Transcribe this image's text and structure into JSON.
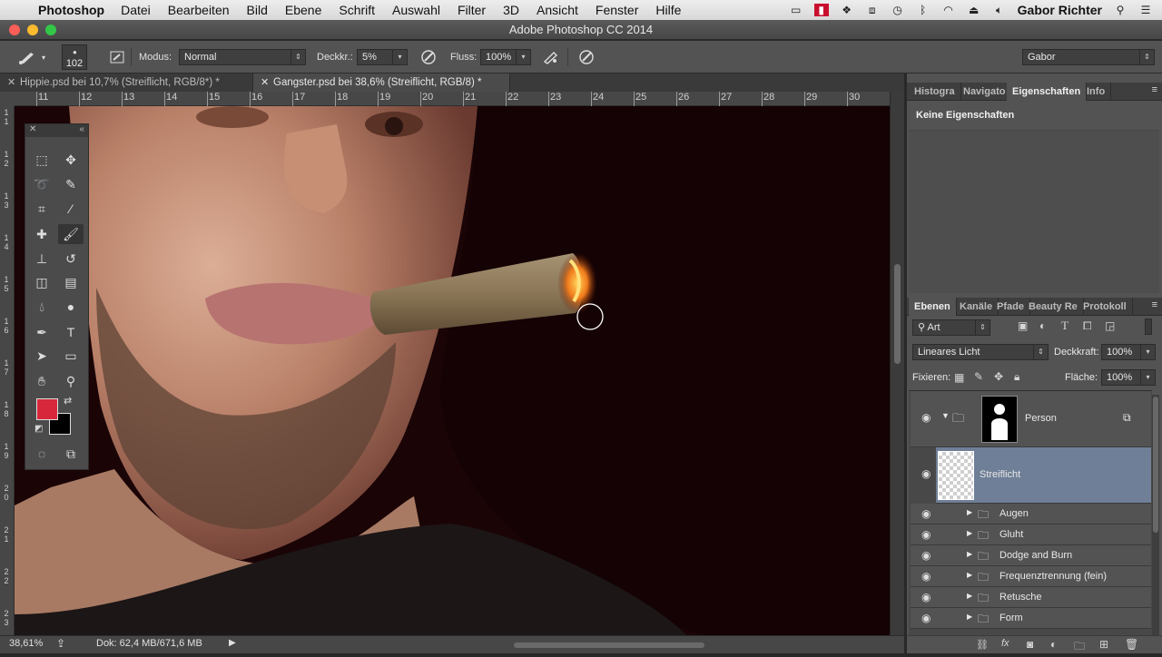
{
  "menubar": {
    "app": "Photoshop",
    "items": [
      "Datei",
      "Bearbeiten",
      "Bild",
      "Ebene",
      "Schrift",
      "Auswahl",
      "Filter",
      "3D",
      "Ansicht",
      "Fenster",
      "Hilfe"
    ],
    "user": "Gabor Richter"
  },
  "window": {
    "title": "Adobe Photoshop CC 2014"
  },
  "options": {
    "brush_size": "102",
    "mode_label": "Modus:",
    "mode_value": "Normal",
    "opacity_label": "Deckkr.:",
    "opacity_value": "5%",
    "flow_label": "Fluss:",
    "flow_value": "100%",
    "workspace": "Gabor"
  },
  "tabs": [
    {
      "label": "Hippie.psd bei 10,7% (Streiflicht, RGB/8*) *"
    },
    {
      "label": "Gangster.psd bei 38,6% (Streiflicht, RGB/8) *"
    }
  ],
  "ruler": {
    "h": [
      "11",
      "12",
      "13",
      "14",
      "15",
      "16",
      "17",
      "18",
      "19",
      "20",
      "21",
      "22",
      "23",
      "24",
      "25",
      "26",
      "27",
      "28",
      "29",
      "30"
    ],
    "v": [
      "1\n1",
      "1\n2",
      "1\n3",
      "1\n4",
      "1\n5",
      "1\n6",
      "1\n7",
      "1\n8",
      "1\n9",
      "2\n0",
      "2\n1",
      "2\n2",
      "2\n3"
    ]
  },
  "status": {
    "zoom": "38,61%",
    "doc": "Dok: 62,4 MB/671,6 MB"
  },
  "properties": {
    "tabs": [
      "Histogra",
      "Navigato",
      "Eigenschaften",
      "Info"
    ],
    "empty_text": "Keine Eigenschaften"
  },
  "layers_panel": {
    "tabs": [
      "Ebenen",
      "Kanäle",
      "Pfade",
      "Beauty Re",
      "Protokoll"
    ],
    "filter": "Art",
    "blend_mode": "Lineares Licht",
    "opacity_label": "Deckkraft:",
    "opacity_value": "100%",
    "lock_label": "Fixieren:",
    "fill_label": "Fläche:",
    "fill_value": "100%",
    "layers": [
      {
        "name": "Person",
        "type": "group-open"
      },
      {
        "name": "Streiflicht",
        "type": "layer"
      },
      {
        "name": "Augen",
        "type": "group"
      },
      {
        "name": "Gluht",
        "type": "group"
      },
      {
        "name": "Dodge and Burn",
        "type": "group"
      },
      {
        "name": "Frequenztrennung (fein)",
        "type": "group"
      },
      {
        "name": "Retusche",
        "type": "group"
      },
      {
        "name": "Form",
        "type": "group"
      }
    ]
  },
  "colors": {
    "foreground": "#d6283a",
    "background": "#000000",
    "selection": "#6f7f97"
  }
}
